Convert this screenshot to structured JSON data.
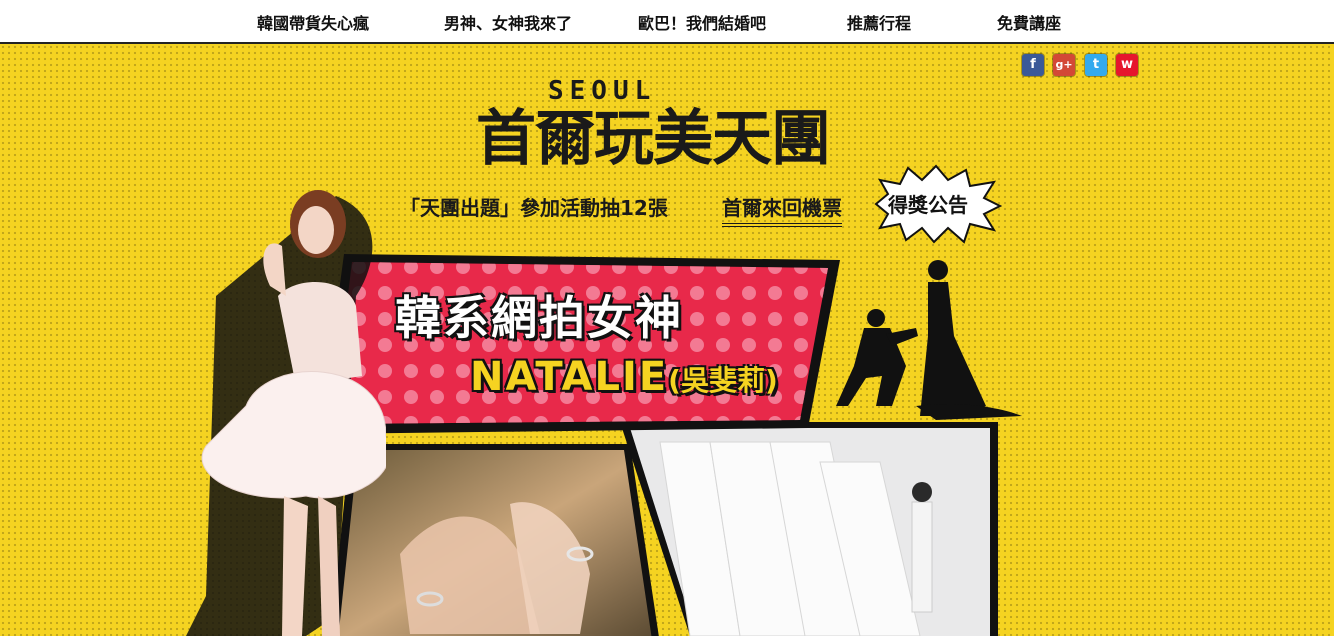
{
  "nav": {
    "items": [
      {
        "label": "韓國帶貨失心瘋"
      },
      {
        "label": "男神、女神我來了"
      },
      {
        "label": "歐巴！我們結婚吧"
      },
      {
        "label": "推薦行程"
      },
      {
        "label": "免費講座"
      }
    ]
  },
  "social": {
    "icons": [
      "facebook-icon",
      "google-plus-icon",
      "twitter-icon",
      "weibo-icon"
    ],
    "colors": {
      "facebook": "#3b5998",
      "google": "#d34836",
      "twitter": "#33aaee",
      "weibo": "#e6162d"
    }
  },
  "logo": {
    "seoul": "SEOUL",
    "main": "首爾玩美天團"
  },
  "promo": {
    "text": "「天團出題」參加活動抽12張",
    "highlight": "首爾來回機票",
    "badge": "得獎公告"
  },
  "banner": {
    "title": "韓系網拍女神",
    "name": "NATALIE",
    "name_cn": "(吳斐莉)"
  },
  "colors": {
    "stage": "#f5d321",
    "banner": "#e8294a",
    "ink": "#1a1a1a"
  }
}
